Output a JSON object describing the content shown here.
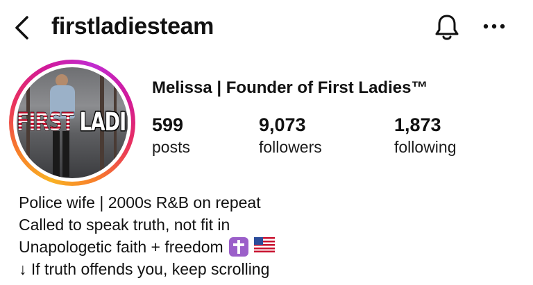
{
  "header": {
    "username": "firstladiesteam",
    "icons": {
      "back": "chevron-left-icon",
      "notifications": "bell-icon",
      "more": "more-horizontal-icon"
    }
  },
  "avatar": {
    "overlay_text_flag_part": "FIRST",
    "overlay_text_rest": "LADIES",
    "ring_colors": [
      "#f9b224",
      "#f77a2b",
      "#e8305f",
      "#d1199b",
      "#c02cd0"
    ]
  },
  "profile": {
    "display_name": "Melissa | Founder of First Ladies™",
    "stats": [
      {
        "value": "599",
        "label": "posts"
      },
      {
        "value": "9,073",
        "label": "followers"
      },
      {
        "value": "1,873",
        "label": "following"
      }
    ]
  },
  "bio": {
    "lines": [
      "Police wife | 2000s R&B on repeat",
      "Called to speak truth, not fit in",
      "Unapologetic faith + freedom",
      "↓ If truth offends you, keep scrolling"
    ],
    "emojis": [
      "latin-cross-icon",
      "us-flag-icon"
    ]
  },
  "colors": {
    "text": "#111111",
    "background": "#ffffff",
    "cross_emoji_bg": "#9b5fc9"
  }
}
